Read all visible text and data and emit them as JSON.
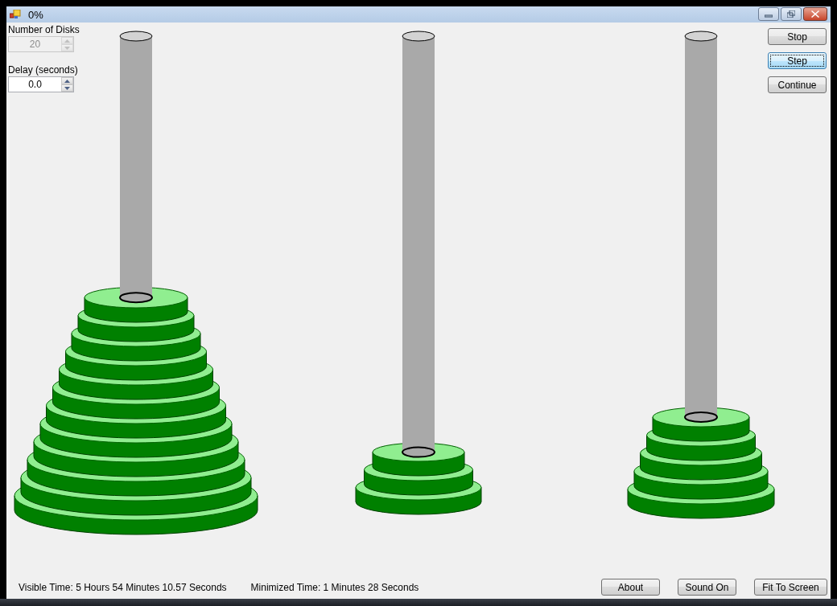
{
  "window": {
    "title": "0%"
  },
  "spinners": [
    {
      "label": "Number of Disks",
      "value": "20",
      "disabled": true
    },
    {
      "label": "Delay (seconds)",
      "value": "0.0",
      "disabled": false
    }
  ],
  "side_buttons": [
    {
      "label": "Stop",
      "focused": false
    },
    {
      "label": "Step",
      "focused": true
    },
    {
      "label": "Continue",
      "focused": false
    }
  ],
  "status": {
    "visible_time": "Visible Time: 5 Hours  54 Minutes  10.57 Seconds",
    "minimized_time": "Minimized Time: 1 Minutes  28 Seconds"
  },
  "bottom_buttons": [
    {
      "label": "About",
      "focused": false
    },
    {
      "label": "Sound On",
      "focused": false
    },
    {
      "label": "Fit To Screen",
      "focused": false
    }
  ]
}
